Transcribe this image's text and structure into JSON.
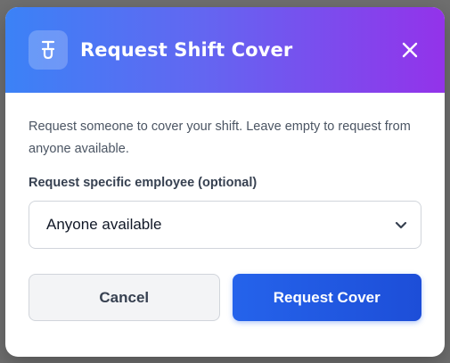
{
  "dialog": {
    "title": "Request Shift Cover",
    "header_icon": "hand-raise-icon",
    "close_icon": "close-icon"
  },
  "body": {
    "description": "Request someone to cover your shift. Leave empty to request from anyone available.",
    "field_label": "Request specific employee (optional)",
    "select": {
      "selected": "Anyone available",
      "icon": "chevron-down-icon"
    }
  },
  "actions": {
    "cancel_label": "Cancel",
    "submit_label": "Request Cover"
  },
  "colors": {
    "header_gradient_start": "#3b82f6",
    "header_gradient_end": "#9333ea",
    "primary_button": "#2563eb",
    "backdrop": "#6f6f6f"
  }
}
